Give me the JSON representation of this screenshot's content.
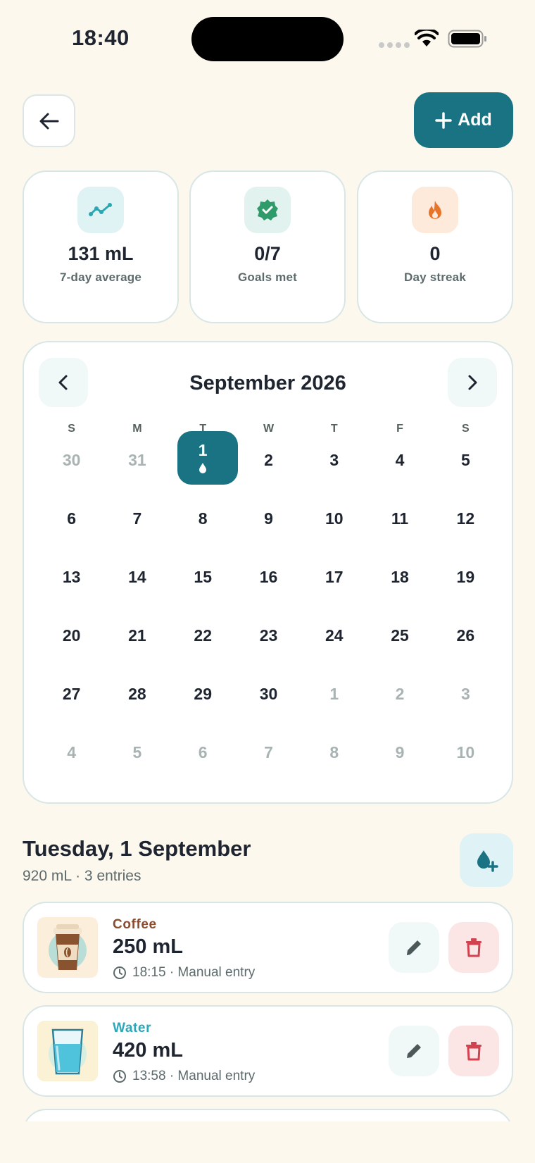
{
  "status": {
    "time": "18:40"
  },
  "header": {
    "add_label": "Add"
  },
  "stats": [
    {
      "value": "131 mL",
      "label": "7-day average",
      "icon": "trend-icon",
      "color": "#2aa7b0"
    },
    {
      "value": "0/7",
      "label": "Goals met",
      "icon": "verified-badge-icon",
      "color": "#2f9a6a"
    },
    {
      "value": "0",
      "label": "Day streak",
      "icon": "flame-icon",
      "color": "#e8742a"
    }
  ],
  "calendar": {
    "title": "September 2026",
    "weekdays": [
      "S",
      "M",
      "T",
      "W",
      "T",
      "F",
      "S"
    ],
    "days": [
      {
        "n": "30",
        "muted": true
      },
      {
        "n": "31",
        "muted": true
      },
      {
        "n": "1",
        "selected": true,
        "has_entries": true
      },
      {
        "n": "2"
      },
      {
        "n": "3"
      },
      {
        "n": "4"
      },
      {
        "n": "5"
      },
      {
        "n": "6"
      },
      {
        "n": "7"
      },
      {
        "n": "8"
      },
      {
        "n": "9"
      },
      {
        "n": "10"
      },
      {
        "n": "11"
      },
      {
        "n": "12"
      },
      {
        "n": "13"
      },
      {
        "n": "14"
      },
      {
        "n": "15"
      },
      {
        "n": "16"
      },
      {
        "n": "17"
      },
      {
        "n": "18"
      },
      {
        "n": "19"
      },
      {
        "n": "20"
      },
      {
        "n": "21"
      },
      {
        "n": "22"
      },
      {
        "n": "23"
      },
      {
        "n": "24"
      },
      {
        "n": "25"
      },
      {
        "n": "26"
      },
      {
        "n": "27"
      },
      {
        "n": "28"
      },
      {
        "n": "29"
      },
      {
        "n": "30"
      },
      {
        "n": "1",
        "muted": true
      },
      {
        "n": "2",
        "muted": true
      },
      {
        "n": "3",
        "muted": true
      },
      {
        "n": "4",
        "muted": true
      },
      {
        "n": "5",
        "muted": true
      },
      {
        "n": "6",
        "muted": true
      },
      {
        "n": "7",
        "muted": true
      },
      {
        "n": "8",
        "muted": true
      },
      {
        "n": "9",
        "muted": true
      },
      {
        "n": "10",
        "muted": true
      }
    ]
  },
  "day": {
    "title": "Tuesday, 1 September",
    "summary": "920 mL · 3 entries"
  },
  "entries": [
    {
      "type": "Coffee",
      "type_color": "#8a4b2e",
      "amount": "250 mL",
      "meta": "18:15 · Manual entry",
      "icon": "coffee-cup-icon"
    },
    {
      "type": "Water",
      "type_color": "#2aa7b8",
      "amount": "420 mL",
      "meta": "13:58 · Manual entry",
      "icon": "water-glass-icon"
    }
  ],
  "colors": {
    "accent": "#1a7383",
    "background": "#fdf8ee",
    "danger": "#d0434f"
  }
}
